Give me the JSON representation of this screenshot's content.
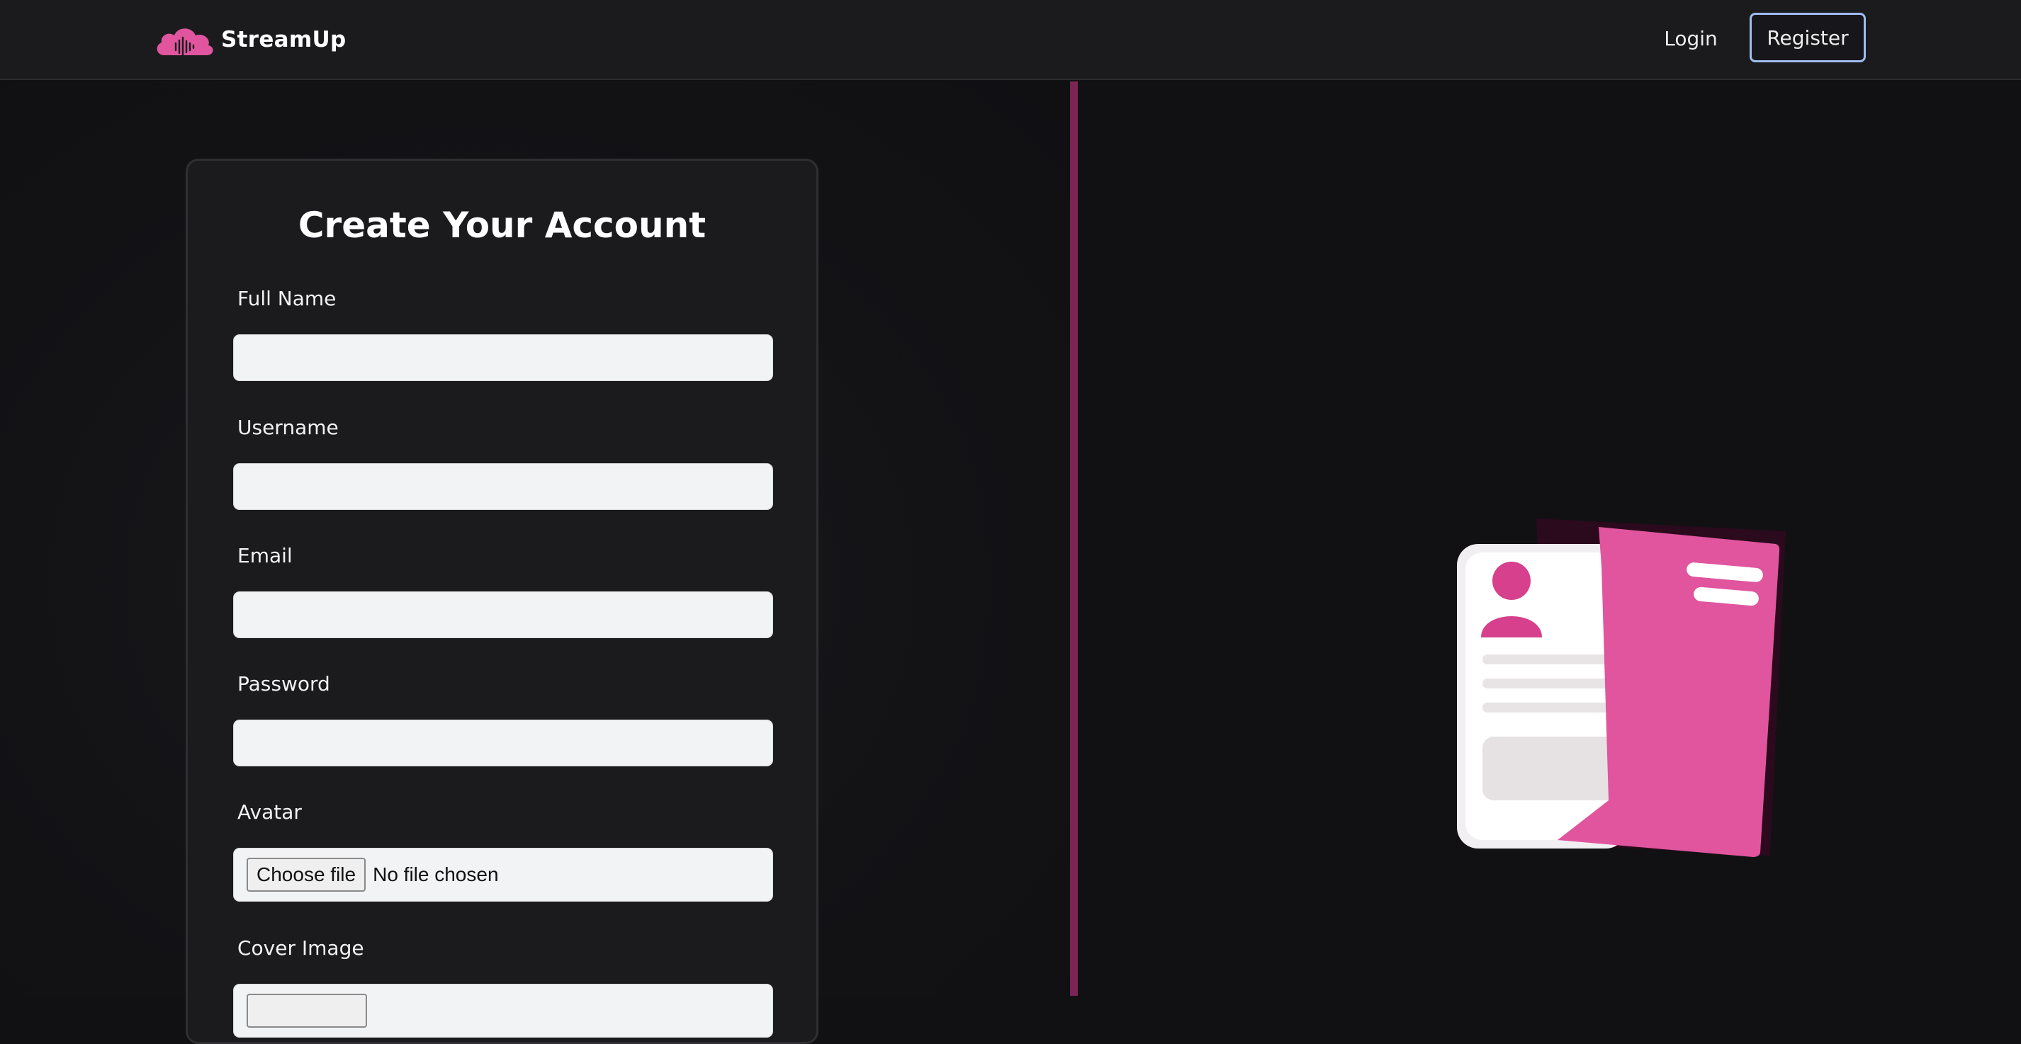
{
  "header": {
    "brand_name": "StreamUp",
    "brand_icon": "cloud-soundwave-logo",
    "nav": {
      "login_label": "Login",
      "register_label": "Register"
    }
  },
  "form": {
    "title": "Create Your Account",
    "fields": {
      "full_name": {
        "label": "Full Name",
        "value": ""
      },
      "username": {
        "label": "Username",
        "value": ""
      },
      "email": {
        "label": "Email",
        "value": ""
      },
      "password": {
        "label": "Password",
        "value": ""
      },
      "avatar": {
        "label": "Avatar",
        "button_label": "Choose file",
        "status": "No file chosen"
      },
      "cover_image": {
        "label": "Cover Image"
      }
    }
  },
  "illustration": {
    "icon": "id-card-document-icon"
  },
  "colors": {
    "accent_pink": "#e0559e",
    "divider": "#7a2552",
    "header_bg": "#1b1b1e",
    "card_bg": "#1b1b1e",
    "page_bg": "#111114",
    "register_border": "#9ebcf0"
  }
}
